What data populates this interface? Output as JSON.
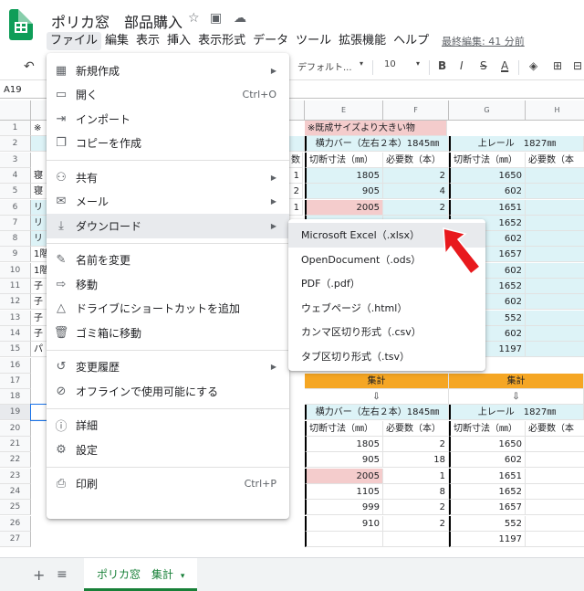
{
  "app": {
    "doc_title": "ポリカ窓　部品購入",
    "menus": [
      "ファイル",
      "編集",
      "表示",
      "挿入",
      "表示形式",
      "データ",
      "ツール",
      "拡張機能",
      "ヘルプ"
    ],
    "last_edit": "最終編集: 41 分前"
  },
  "toolbar": {
    "font": "デフォルト...",
    "font_size": "10",
    "bold": "B",
    "italic": "I",
    "strike": "S",
    "text_color": "A"
  },
  "name_box": "A19",
  "columns": {
    "E": "E",
    "F": "F",
    "G": "G",
    "H": "H"
  },
  "rows": [
    "1",
    "2",
    "3",
    "4",
    "5",
    "6",
    "7",
    "8",
    "9",
    "10",
    "11",
    "12",
    "13",
    "14",
    "15",
    "16",
    "17",
    "18",
    "19",
    "20",
    "21",
    "22",
    "23",
    "24",
    "25",
    "26",
    "27"
  ],
  "left_cells": {
    "r1": "※",
    "r4": "寝",
    "r5": "寝",
    "r6": "リ",
    "r7": "リ",
    "r8": "リ",
    "r9": "1階",
    "r10": "1階",
    "r11": "子",
    "r12": "子",
    "r13": "子",
    "r14": "子",
    "r15": "パ"
  },
  "d_partial": {
    "r3": "数",
    "r4": "1",
    "r5": "2",
    "r6": "1"
  },
  "right_top": {
    "e1_note": "※既成サイズより大きい物",
    "e2_header": "横力バー（左右２本）1845㎜",
    "g2_header": "上レール　1827㎜",
    "sub_e": "切断寸法（㎜）",
    "sub_f": "必要数（本）",
    "sub_g": "切断寸法（㎜）",
    "sub_h": "必要数（本",
    "rows": [
      {
        "e": "1805",
        "f": "2",
        "g": "1650"
      },
      {
        "e": "905",
        "f": "4",
        "g": "602"
      },
      {
        "e": "2005",
        "f": "2",
        "g": "1651"
      },
      {
        "e": "",
        "f": "",
        "g": "1652"
      },
      {
        "e": "",
        "f": "",
        "g": "602"
      },
      {
        "e": "",
        "f": "",
        "g": "1657"
      },
      {
        "e": "",
        "f": "",
        "g": "602"
      },
      {
        "e": "",
        "f": "",
        "g": "1652"
      },
      {
        "e": "",
        "f": "",
        "g": "602"
      },
      {
        "e": "",
        "f": "",
        "g": "552"
      },
      {
        "e": "",
        "f": "",
        "g": "602"
      },
      {
        "e": "",
        "f": "",
        "g": "1197"
      }
    ]
  },
  "right_bottom": {
    "total_label": "集計",
    "down_arrow": "⇩",
    "e_header": "横力バー（左右２本）1845㎜",
    "g_header": "上レール　1827㎜",
    "sub_e": "切断寸法（㎜）",
    "sub_f": "必要数（本）",
    "sub_g": "切断寸法（㎜）",
    "sub_h": "必要数（本",
    "rows": [
      {
        "e": "1805",
        "f": "2",
        "g": "1650"
      },
      {
        "e": "905",
        "f": "18",
        "g": "602"
      },
      {
        "e": "2005",
        "f": "1",
        "g": "1651"
      },
      {
        "e": "1105",
        "f": "8",
        "g": "1652"
      },
      {
        "e": "999",
        "f": "2",
        "g": "1657"
      },
      {
        "e": "910",
        "f": "2",
        "g": "552"
      },
      {
        "e": "",
        "f": "",
        "g": "1197"
      }
    ]
  },
  "file_menu": {
    "items": [
      {
        "label": "新規作成",
        "icon": "new-icon",
        "arrow": true
      },
      {
        "label": "開く",
        "icon": "folder-icon",
        "shortcut": "Ctrl+O"
      },
      {
        "label": "インポート",
        "icon": "import-icon"
      },
      {
        "label": "コピーを作成",
        "icon": "copy-icon"
      },
      {
        "label": "共有",
        "icon": "share-icon",
        "arrow": true
      },
      {
        "label": "メール",
        "icon": "mail-icon",
        "arrow": true
      },
      {
        "label": "ダウンロード",
        "icon": "download-icon",
        "arrow": true
      },
      {
        "label": "名前を変更",
        "icon": "rename-icon"
      },
      {
        "label": "移動",
        "icon": "move-icon"
      },
      {
        "label": "ドライブにショートカットを追加",
        "icon": "drive-shortcut-icon"
      },
      {
        "label": "ゴミ箱に移動",
        "icon": "trash-icon"
      },
      {
        "label": "変更履歴",
        "icon": "history-icon",
        "arrow": true
      },
      {
        "label": "オフラインで使用可能にする",
        "icon": "offline-icon"
      },
      {
        "label": "詳細",
        "icon": "info-icon"
      },
      {
        "label": "設定",
        "icon": "settings-icon"
      },
      {
        "label": "印刷",
        "icon": "print-icon",
        "shortcut": "Ctrl+P"
      }
    ]
  },
  "download_submenu": {
    "items": [
      "Microsoft Excel（.xlsx）",
      "OpenDocument（.ods）",
      "PDF（.pdf）",
      "ウェブページ（.html）",
      "カンマ区切り形式（.csv）",
      "タブ区切り形式（.tsv）"
    ]
  },
  "sheet_tab": {
    "name": "ポリカ窓　集計"
  },
  "colors": {
    "accent_green": "#0f9d58",
    "sheet_blue": "#ddf3f7",
    "sheet_pink": "#f4cccc",
    "sheet_orange": "#f5a623",
    "arrow_red": "#e8191d"
  }
}
